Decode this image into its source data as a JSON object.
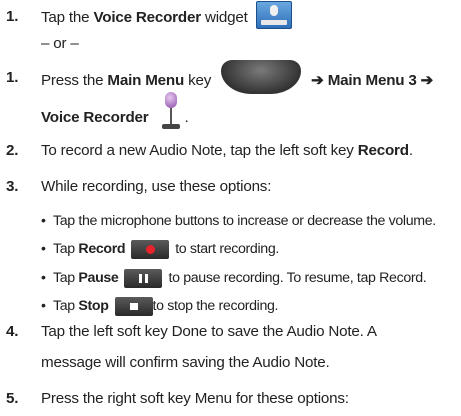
{
  "steps": {
    "s1": {
      "num": "1.",
      "pre": "Tap the ",
      "bold": "Voice Recorder",
      "post": " widget"
    },
    "or": "– or –",
    "s1b": {
      "num": "1.",
      "pre": "Press the ",
      "bold": "Main Menu",
      "mid": " key",
      "arrow": "➔ Main Menu 3 ➔"
    },
    "s1b_line2": {
      "bold": "Voice Recorder",
      "post": "."
    },
    "s2": {
      "num": "2.",
      "pre": "To record a new Audio Note, tap the left soft key ",
      "bold": "Record",
      "post": "."
    },
    "s3": {
      "num": "3.",
      "text": "While recording, use these options:"
    },
    "bullets": [
      {
        "text": "Tap the microphone buttons to increase or decrease the volume."
      },
      {
        "pre": "Tap ",
        "bold": "Record",
        "post": "to start recording."
      },
      {
        "pre": "Tap ",
        "bold": "Pause",
        "post": "to pause recording. To resume, tap Record."
      },
      {
        "pre": "Tap ",
        "bold": "Stop",
        "post": "to stop the recording."
      }
    ],
    "s4": {
      "num": "4.",
      "line1": "Tap the left soft key Done to save the Audio Note. A",
      "line2": "message will confirm saving the Audio Note."
    },
    "s5": {
      "num": "5.",
      "text": "Press the right soft key Menu for these options:"
    }
  },
  "icons": {
    "recorder_widget": "voice-recorder-widget-icon",
    "main_menu_key": "main-menu-key-icon",
    "microphone_app": "microphone-app-icon",
    "record": "record-icon",
    "pause": "pause-icon",
    "stop": "stop-icon"
  },
  "colors": {
    "text": "#222222",
    "record_dot": "#e8232a",
    "icon_dark": "#2a2a2a"
  }
}
